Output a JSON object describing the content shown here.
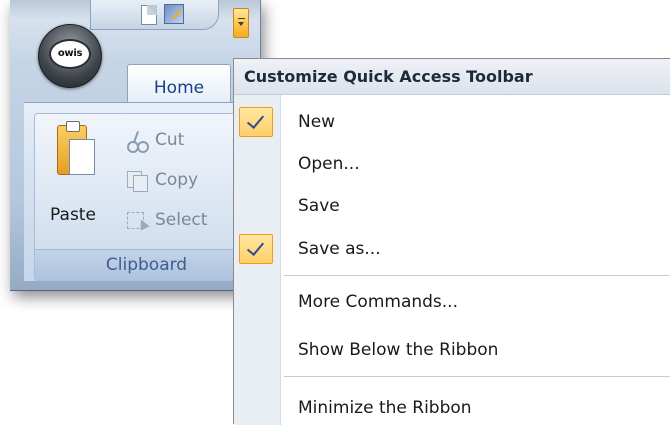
{
  "qat": {
    "new_icon": "new-document-icon",
    "save_as_icon": "save-as-icon",
    "dropdown_icon": "customize-dropdown-arrow-icon"
  },
  "office_button": {
    "label": "owis"
  },
  "ribbon": {
    "tab": "Home",
    "clipboard": {
      "paste": "Paste",
      "cut": "Cut",
      "copy": "Copy",
      "select": "Select",
      "caption": "Clipboard"
    }
  },
  "menu": {
    "header": "Customize Quick Access Toolbar",
    "items": [
      {
        "label": "New",
        "checked": true
      },
      {
        "label": "Open...",
        "checked": false
      },
      {
        "label": "Save",
        "checked": false
      },
      {
        "label": "Save as...",
        "checked": true
      },
      {
        "label": "More Commands..."
      },
      {
        "label": "Show Below the Ribbon"
      },
      {
        "label": "Minimize the Ribbon"
      }
    ]
  },
  "colors": {
    "check_highlight": "#ffcf69",
    "ribbon_text": "#15428b"
  }
}
